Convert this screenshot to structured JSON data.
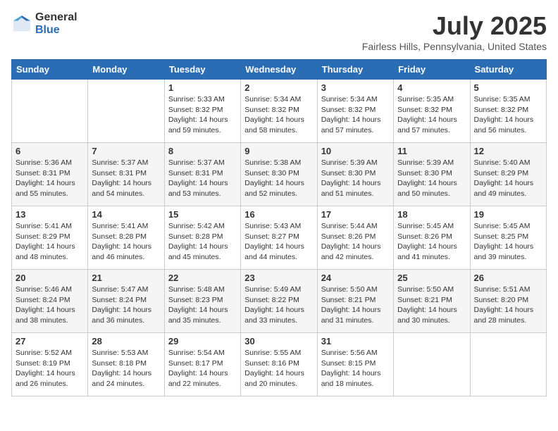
{
  "logo": {
    "general": "General",
    "blue": "Blue"
  },
  "header": {
    "month": "July 2025",
    "location": "Fairless Hills, Pennsylvania, United States"
  },
  "weekdays": [
    "Sunday",
    "Monday",
    "Tuesday",
    "Wednesday",
    "Thursday",
    "Friday",
    "Saturday"
  ],
  "weeks": [
    [
      null,
      null,
      {
        "day": 1,
        "sunrise": "Sunrise: 5:33 AM",
        "sunset": "Sunset: 8:32 PM",
        "daylight": "Daylight: 14 hours and 59 minutes."
      },
      {
        "day": 2,
        "sunrise": "Sunrise: 5:34 AM",
        "sunset": "Sunset: 8:32 PM",
        "daylight": "Daylight: 14 hours and 58 minutes."
      },
      {
        "day": 3,
        "sunrise": "Sunrise: 5:34 AM",
        "sunset": "Sunset: 8:32 PM",
        "daylight": "Daylight: 14 hours and 57 minutes."
      },
      {
        "day": 4,
        "sunrise": "Sunrise: 5:35 AM",
        "sunset": "Sunset: 8:32 PM",
        "daylight": "Daylight: 14 hours and 57 minutes."
      },
      {
        "day": 5,
        "sunrise": "Sunrise: 5:35 AM",
        "sunset": "Sunset: 8:32 PM",
        "daylight": "Daylight: 14 hours and 56 minutes."
      }
    ],
    [
      {
        "day": 6,
        "sunrise": "Sunrise: 5:36 AM",
        "sunset": "Sunset: 8:31 PM",
        "daylight": "Daylight: 14 hours and 55 minutes."
      },
      {
        "day": 7,
        "sunrise": "Sunrise: 5:37 AM",
        "sunset": "Sunset: 8:31 PM",
        "daylight": "Daylight: 14 hours and 54 minutes."
      },
      {
        "day": 8,
        "sunrise": "Sunrise: 5:37 AM",
        "sunset": "Sunset: 8:31 PM",
        "daylight": "Daylight: 14 hours and 53 minutes."
      },
      {
        "day": 9,
        "sunrise": "Sunrise: 5:38 AM",
        "sunset": "Sunset: 8:30 PM",
        "daylight": "Daylight: 14 hours and 52 minutes."
      },
      {
        "day": 10,
        "sunrise": "Sunrise: 5:39 AM",
        "sunset": "Sunset: 8:30 PM",
        "daylight": "Daylight: 14 hours and 51 minutes."
      },
      {
        "day": 11,
        "sunrise": "Sunrise: 5:39 AM",
        "sunset": "Sunset: 8:30 PM",
        "daylight": "Daylight: 14 hours and 50 minutes."
      },
      {
        "day": 12,
        "sunrise": "Sunrise: 5:40 AM",
        "sunset": "Sunset: 8:29 PM",
        "daylight": "Daylight: 14 hours and 49 minutes."
      }
    ],
    [
      {
        "day": 13,
        "sunrise": "Sunrise: 5:41 AM",
        "sunset": "Sunset: 8:29 PM",
        "daylight": "Daylight: 14 hours and 48 minutes."
      },
      {
        "day": 14,
        "sunrise": "Sunrise: 5:41 AM",
        "sunset": "Sunset: 8:28 PM",
        "daylight": "Daylight: 14 hours and 46 minutes."
      },
      {
        "day": 15,
        "sunrise": "Sunrise: 5:42 AM",
        "sunset": "Sunset: 8:28 PM",
        "daylight": "Daylight: 14 hours and 45 minutes."
      },
      {
        "day": 16,
        "sunrise": "Sunrise: 5:43 AM",
        "sunset": "Sunset: 8:27 PM",
        "daylight": "Daylight: 14 hours and 44 minutes."
      },
      {
        "day": 17,
        "sunrise": "Sunrise: 5:44 AM",
        "sunset": "Sunset: 8:26 PM",
        "daylight": "Daylight: 14 hours and 42 minutes."
      },
      {
        "day": 18,
        "sunrise": "Sunrise: 5:45 AM",
        "sunset": "Sunset: 8:26 PM",
        "daylight": "Daylight: 14 hours and 41 minutes."
      },
      {
        "day": 19,
        "sunrise": "Sunrise: 5:45 AM",
        "sunset": "Sunset: 8:25 PM",
        "daylight": "Daylight: 14 hours and 39 minutes."
      }
    ],
    [
      {
        "day": 20,
        "sunrise": "Sunrise: 5:46 AM",
        "sunset": "Sunset: 8:24 PM",
        "daylight": "Daylight: 14 hours and 38 minutes."
      },
      {
        "day": 21,
        "sunrise": "Sunrise: 5:47 AM",
        "sunset": "Sunset: 8:24 PM",
        "daylight": "Daylight: 14 hours and 36 minutes."
      },
      {
        "day": 22,
        "sunrise": "Sunrise: 5:48 AM",
        "sunset": "Sunset: 8:23 PM",
        "daylight": "Daylight: 14 hours and 35 minutes."
      },
      {
        "day": 23,
        "sunrise": "Sunrise: 5:49 AM",
        "sunset": "Sunset: 8:22 PM",
        "daylight": "Daylight: 14 hours and 33 minutes."
      },
      {
        "day": 24,
        "sunrise": "Sunrise: 5:50 AM",
        "sunset": "Sunset: 8:21 PM",
        "daylight": "Daylight: 14 hours and 31 minutes."
      },
      {
        "day": 25,
        "sunrise": "Sunrise: 5:50 AM",
        "sunset": "Sunset: 8:21 PM",
        "daylight": "Daylight: 14 hours and 30 minutes."
      },
      {
        "day": 26,
        "sunrise": "Sunrise: 5:51 AM",
        "sunset": "Sunset: 8:20 PM",
        "daylight": "Daylight: 14 hours and 28 minutes."
      }
    ],
    [
      {
        "day": 27,
        "sunrise": "Sunrise: 5:52 AM",
        "sunset": "Sunset: 8:19 PM",
        "daylight": "Daylight: 14 hours and 26 minutes."
      },
      {
        "day": 28,
        "sunrise": "Sunrise: 5:53 AM",
        "sunset": "Sunset: 8:18 PM",
        "daylight": "Daylight: 14 hours and 24 minutes."
      },
      {
        "day": 29,
        "sunrise": "Sunrise: 5:54 AM",
        "sunset": "Sunset: 8:17 PM",
        "daylight": "Daylight: 14 hours and 22 minutes."
      },
      {
        "day": 30,
        "sunrise": "Sunrise: 5:55 AM",
        "sunset": "Sunset: 8:16 PM",
        "daylight": "Daylight: 14 hours and 20 minutes."
      },
      {
        "day": 31,
        "sunrise": "Sunrise: 5:56 AM",
        "sunset": "Sunset: 8:15 PM",
        "daylight": "Daylight: 14 hours and 18 minutes."
      },
      null,
      null
    ]
  ]
}
